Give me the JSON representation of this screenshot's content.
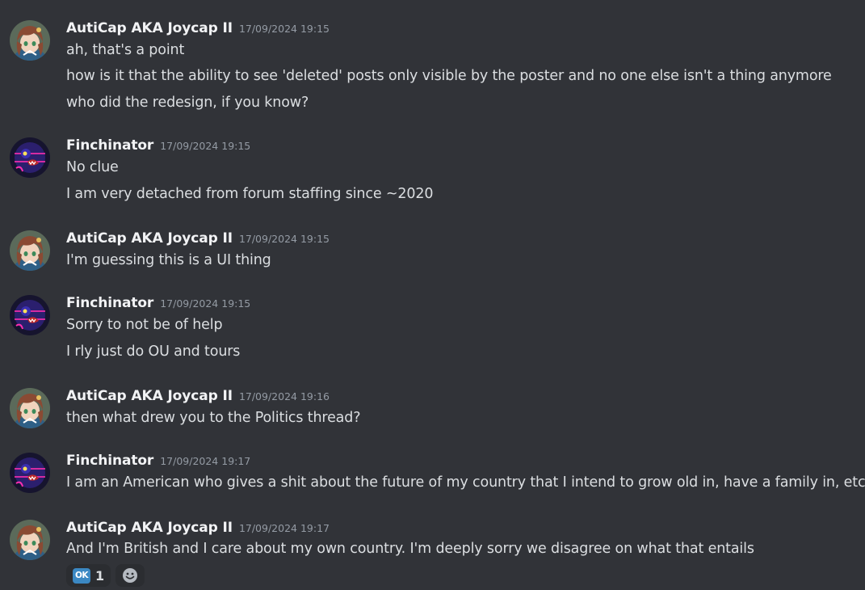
{
  "colors": {
    "background": "#313338",
    "username": "#f2f3f5",
    "timestamp": "#949ba4",
    "text": "#dbdee1",
    "reaction_bg": "#2b2d31",
    "ok_blue": "#3b88c3"
  },
  "messages": [
    {
      "author": "AutiCap AKA Joycap II",
      "avatar": "anime-girl-avatar",
      "timestamp": "17/09/2024 19:15",
      "lines": [
        "ah, that's a point",
        "how is it that the ability to see 'deleted' posts only visible by the poster and no one else isn't a thing anymore",
        "who did the redesign, if you know?"
      ]
    },
    {
      "author": "Finchinator",
      "avatar": "dark-creature-avatar",
      "timestamp": "17/09/2024 19:15",
      "lines": [
        "No clue",
        "I am very detached from forum staffing since ~2020"
      ]
    },
    {
      "author": "AutiCap AKA Joycap II",
      "avatar": "anime-girl-avatar",
      "timestamp": "17/09/2024 19:15",
      "lines": [
        "I'm guessing this is a UI thing"
      ]
    },
    {
      "author": "Finchinator",
      "avatar": "dark-creature-avatar",
      "timestamp": "17/09/2024 19:15",
      "lines": [
        "Sorry to not be of help",
        "I rly just do OU and tours"
      ]
    },
    {
      "author": "AutiCap AKA Joycap II",
      "avatar": "anime-girl-avatar",
      "timestamp": "17/09/2024 19:16",
      "lines": [
        "then what drew you to the Politics thread?"
      ]
    },
    {
      "author": "Finchinator",
      "avatar": "dark-creature-avatar",
      "timestamp": "17/09/2024 19:17",
      "lines": [
        "I am an American who gives a shit about the future of my country that I intend to grow old in, have a family in, etc"
      ]
    },
    {
      "author": "AutiCap AKA Joycap II",
      "avatar": "anime-girl-avatar",
      "timestamp": "17/09/2024 19:17",
      "lines": [
        "And I'm British and I care about my own country. I'm deeply sorry we disagree on what that entails"
      ],
      "reactions": [
        {
          "emoji": "ok-button-emoji",
          "label": "OK",
          "count": "1"
        }
      ],
      "add_reaction_icon": "add-reaction-icon"
    }
  ]
}
